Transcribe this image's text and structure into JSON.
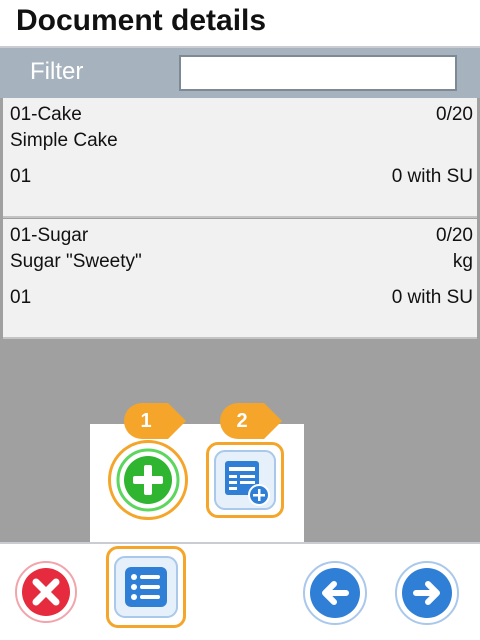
{
  "header": {
    "title": "Document details"
  },
  "filter": {
    "label": "Filter",
    "value": "",
    "placeholder": ""
  },
  "items": [
    {
      "code": "01-Cake",
      "quantity": "0/20",
      "name": "Simple Cake",
      "unit": "",
      "batch": "01",
      "su_status": "0 with SU"
    },
    {
      "code": "01-Sugar",
      "quantity": "0/20",
      "name": "Sugar \"Sweety\"",
      "unit": "kg",
      "batch": "01",
      "su_status": "0 with SU"
    }
  ],
  "callouts": {
    "first": "1",
    "second": "2"
  },
  "icons": {
    "add": "plus-circle-icon",
    "add_document": "document-plus-icon",
    "cancel": "close-icon",
    "list": "list-icon",
    "back": "arrow-left-icon",
    "forward": "arrow-right-icon"
  },
  "colors": {
    "accent_orange": "#f4a52a",
    "add_green": "#2fb52f",
    "cancel_red": "#e52b3d",
    "nav_blue": "#2f7fd6",
    "filter_bar": "#a6b3be"
  }
}
